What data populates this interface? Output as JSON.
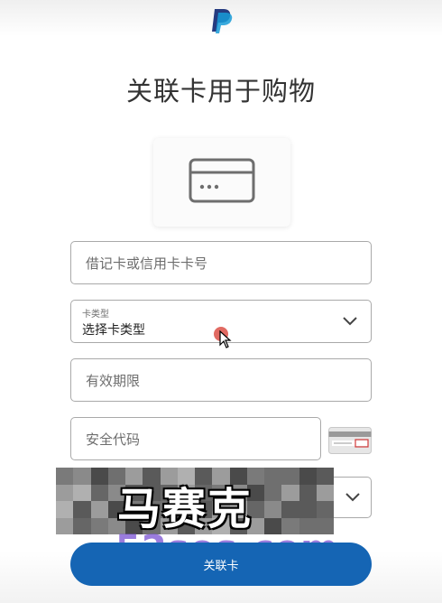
{
  "page": {
    "title": "关联卡用于购物"
  },
  "form": {
    "card_number_placeholder": "借记卡或信用卡卡号",
    "card_type_label": "卡类型",
    "card_type_value": "选择卡类型",
    "expiry_placeholder": "有效期限",
    "security_code_placeholder": "安全代码"
  },
  "overlay": {
    "caption": "马赛克",
    "watermark": "52sos.com"
  },
  "actions": {
    "submit_label": "关联卡"
  },
  "colors": {
    "brand_blue": "#1565b4",
    "logo_dark": "#253b80",
    "logo_light": "#179bd7"
  },
  "icons": {
    "logo": "paypal-logo",
    "card": "credit-card-icon",
    "dropdown": "chevron-down-icon",
    "cvv": "card-back-cvv-icon"
  }
}
